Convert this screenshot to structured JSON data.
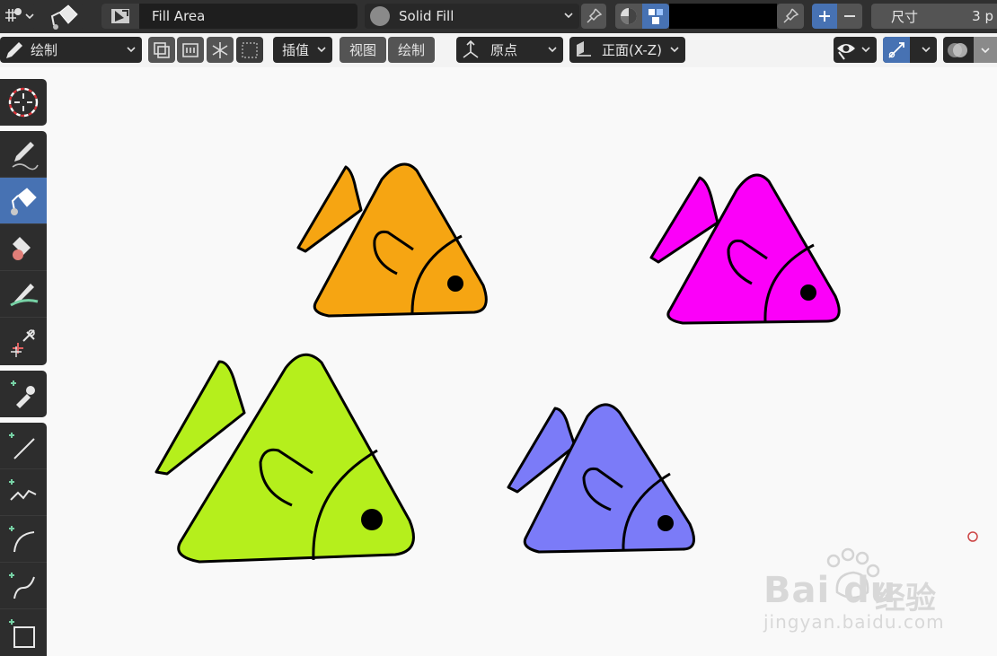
{
  "header": {
    "mode_label": "Fill Area",
    "fill_mode_label": "Solid Fill",
    "size_label": "尺寸",
    "size_value": "3 p",
    "color_swatch": "#000000"
  },
  "toolbar2": {
    "mode_dropdown": "绘制",
    "interpolate_button": "插值",
    "view_menu": "视图",
    "draw_menu": "绘制",
    "origin_dropdown": "原点",
    "plane_dropdown": "正面(X-Z)"
  },
  "tools": {
    "cursor": "cursor-icon",
    "draw": "pencil-icon",
    "fill": "fill-bucket-icon",
    "erase": "eraser-icon",
    "tint": "tint-brush-icon",
    "cutter": "cutter-icon",
    "eyedropper": "eyedropper-icon",
    "line": "line-icon",
    "polyline": "polyline-icon",
    "arc": "arc-icon",
    "curve": "curve-icon",
    "box": "box-icon"
  },
  "fish": {
    "orange": "#f6a512",
    "magenta": "#fb00f9",
    "lime": "#b5ef1c",
    "lavender": "#7b7bf8"
  },
  "watermark": {
    "brand": "Bai du",
    "brand_cn": "经验",
    "url": "jingyan.baidu.com"
  },
  "accent": "#4772b3"
}
